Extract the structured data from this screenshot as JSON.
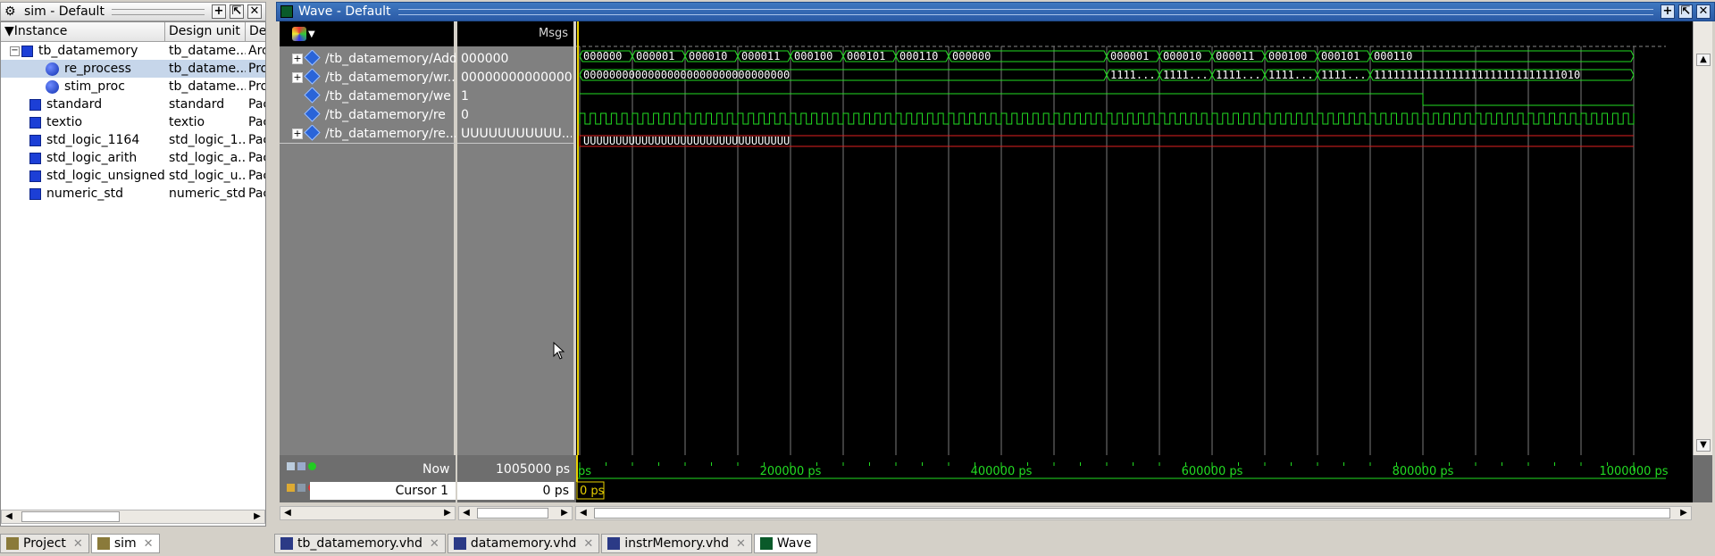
{
  "sim": {
    "title": "sim - Default",
    "headers": [
      "Instance",
      "Design unit",
      "Des"
    ],
    "rows": [
      {
        "name": "tb_datamemory",
        "unit": "tb_datame...",
        "type": "Arc"
      },
      {
        "name": "re_process",
        "unit": "tb_datame...",
        "type": "Pro"
      },
      {
        "name": "stim_proc",
        "unit": "tb_datame...",
        "type": "Pro"
      },
      {
        "name": "standard",
        "unit": "standard",
        "type": "Pac"
      },
      {
        "name": "textio",
        "unit": "textio",
        "type": "Pac"
      },
      {
        "name": "std_logic_1164",
        "unit": "std_logic_1...",
        "type": "Pac"
      },
      {
        "name": "std_logic_arith",
        "unit": "std_logic_a...",
        "type": "Pac"
      },
      {
        "name": "std_logic_unsigned",
        "unit": "std_logic_u...",
        "type": "Pac"
      },
      {
        "name": "numeric_std",
        "unit": "numeric_std",
        "type": "Pac"
      }
    ]
  },
  "wave": {
    "title": "Wave - Default",
    "msgs_label": "Msgs",
    "signals": [
      {
        "name": "/tb_datamemory/Addr",
        "value": "000000",
        "expandable": true
      },
      {
        "name": "/tb_datamemory/wr...",
        "value": "000000000000000...",
        "expandable": true
      },
      {
        "name": "/tb_datamemory/we",
        "value": "1",
        "expandable": false
      },
      {
        "name": "/tb_datamemory/re",
        "value": "0",
        "expandable": false
      },
      {
        "name": "/tb_datamemory/re...",
        "value": "UUUUUUUUUUU...",
        "expandable": true
      }
    ],
    "addr_labels": [
      "000000",
      "000001",
      "000010",
      "000011",
      "000100",
      "000101",
      "000110",
      "000000",
      "000001",
      "000010",
      "000011",
      "000100",
      "000101",
      "000110"
    ],
    "wr_labels": [
      "00000000000000000000000000000000",
      "1111...",
      "1111...",
      "1111...",
      "1111...",
      "1111...",
      "11111111111111111111111111111010"
    ],
    "rd_label": "UUUUUUUUUUUUUUUUUUUUUUUUUUUUUUUU",
    "now_label": "Now",
    "now_value": "1005000 ps",
    "cursor_label": "Cursor 1",
    "cursor_value": "0 ps",
    "cursor_marker": "0 ps",
    "timeline_start": "ps",
    "timeline_ticks": [
      "200000 ps",
      "400000 ps",
      "600000 ps",
      "800000 ps",
      "1000000 ps"
    ]
  },
  "tabs_left": [
    {
      "label": "Project",
      "icon": "project-icon"
    },
    {
      "label": "sim",
      "icon": "sim-icon"
    }
  ],
  "tabs_right": [
    {
      "label": "tb_datamemory.vhd",
      "icon": "vhdl-file-icon"
    },
    {
      "label": "datamemory.vhd",
      "icon": "vhdl-file-icon"
    },
    {
      "label": "instrMemory.vhd",
      "icon": "vhdl-file-icon"
    },
    {
      "label": "Wave",
      "icon": "wave-icon"
    }
  ],
  "colors": {
    "wave_green": "#22dd22",
    "wave_red": "#e02020",
    "cursor_yellow": "#e8d000",
    "grid_gray": "#7a7a7a"
  }
}
